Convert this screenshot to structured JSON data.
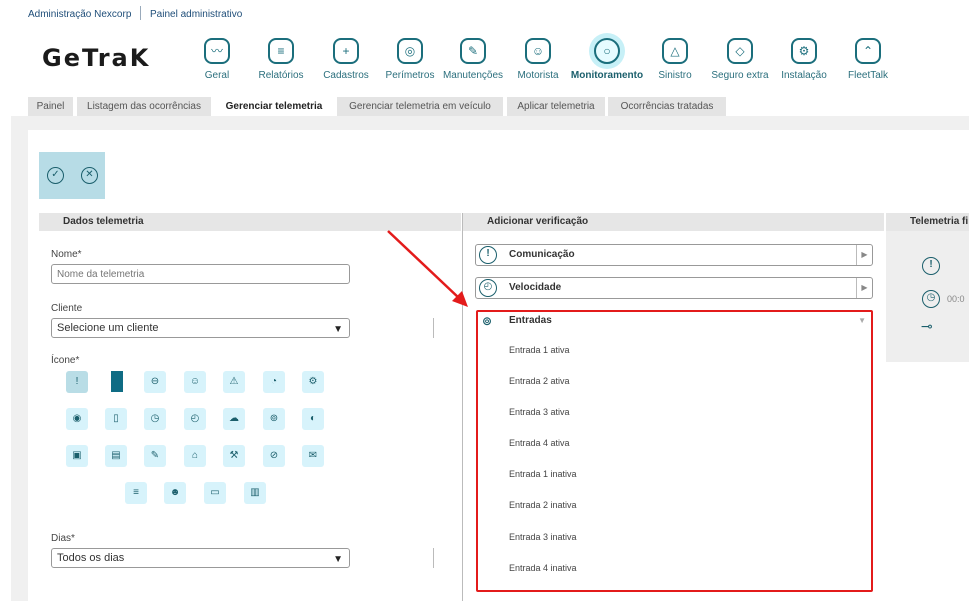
{
  "topbar": {
    "org": "Administração Nexcorp",
    "panel": "Painel administrativo"
  },
  "logo": {
    "text": "GeTraK"
  },
  "nav": [
    {
      "label": "Geral",
      "icon": "chart-icon",
      "glyph": "〰"
    },
    {
      "label": "Relatórios",
      "icon": "report-icon",
      "glyph": "≡"
    },
    {
      "label": "Cadastros",
      "icon": "folder-add-icon",
      "glyph": "+"
    },
    {
      "label": "Perímetros",
      "icon": "perimeter-icon",
      "glyph": "◎"
    },
    {
      "label": "Manutenções",
      "icon": "wrench-icon",
      "glyph": "✎"
    },
    {
      "label": "Motorista",
      "icon": "driver-icon",
      "glyph": "☺"
    },
    {
      "label": "Monitoramento",
      "icon": "monitor-icon",
      "glyph": "○"
    },
    {
      "label": "Sinistro",
      "icon": "alarm-icon",
      "glyph": "△"
    },
    {
      "label": "Seguro extra",
      "icon": "shield-icon",
      "glyph": "◇"
    },
    {
      "label": "Instalação",
      "icon": "install-icon",
      "glyph": "⚙"
    },
    {
      "label": "FleetTalk",
      "icon": "fleettalk-icon",
      "glyph": "⌃"
    }
  ],
  "tabs": [
    "Painel",
    "Listagem das ocorrências",
    "Gerenciar telemetria",
    "Gerenciar telemetria em veículo",
    "Aplicar telemetria",
    "Ocorrências tratadas"
  ],
  "actions": {
    "confirm_icon": "check-icon",
    "cancel_icon": "close-icon",
    "confirm_glyph": "✓",
    "cancel_glyph": "✕"
  },
  "left": {
    "header": "Dados telemetria",
    "name_label": "Nome*",
    "name_placeholder": "Nome da telemetria",
    "client_label": "Cliente",
    "client_value": "Selecione um cliente",
    "icon_label": "Ícone*",
    "days_label": "Dias*",
    "days_value": "Todos os dias"
  },
  "icon_grid": [
    {
      "name": "alert-icon",
      "glyph": "!"
    },
    {
      "name": "block-icon",
      "glyph": ""
    },
    {
      "name": "lock-icon",
      "glyph": "⊖"
    },
    {
      "name": "face-icon",
      "glyph": "☺"
    },
    {
      "name": "warning-icon",
      "glyph": "⚠"
    },
    {
      "name": "gauge-icon",
      "glyph": "◔"
    },
    {
      "name": "settings-icon",
      "glyph": "⚙"
    },
    {
      "name": "eye-icon",
      "glyph": "◉"
    },
    {
      "name": "battery-icon",
      "glyph": "▯"
    },
    {
      "name": "clock-icon",
      "glyph": "◷"
    },
    {
      "name": "speed-icon",
      "glyph": "◴"
    },
    {
      "name": "cloud-icon",
      "glyph": "☁"
    },
    {
      "name": "signal-icon",
      "glyph": "⊚"
    },
    {
      "name": "chat-icon",
      "glyph": "◐"
    },
    {
      "name": "card-icon",
      "glyph": "▣"
    },
    {
      "name": "device-icon",
      "glyph": "▤"
    },
    {
      "name": "pen-icon",
      "glyph": "✎"
    },
    {
      "name": "home-icon",
      "glyph": "⌂"
    },
    {
      "name": "tool-icon",
      "glyph": "⚒"
    },
    {
      "name": "clip-icon",
      "glyph": "⊘"
    },
    {
      "name": "mail-icon",
      "glyph": "✉"
    },
    {
      "name": "list-icon",
      "glyph": "≡"
    },
    {
      "name": "user-icon",
      "glyph": "☻"
    },
    {
      "name": "screen-icon",
      "glyph": "▭"
    },
    {
      "name": "doc-icon",
      "glyph": "▥"
    }
  ],
  "middle": {
    "header": "Adicionar verificação",
    "accordions": [
      {
        "label": "Comunicação",
        "icon": "alert-icon",
        "glyph": "!",
        "expanded": false
      },
      {
        "label": "Velocidade",
        "icon": "speedometer-icon",
        "glyph": "◴",
        "expanded": false
      },
      {
        "label": "Entradas",
        "icon": "signal-icon",
        "glyph": "⊚",
        "expanded": true
      }
    ],
    "entries": [
      "Entrada 1 ativa",
      "Entrada 2 ativa",
      "Entrada 3 ativa",
      "Entrada 4 ativa",
      "Entrada 1 inativa",
      "Entrada 2 inativa",
      "Entrada 3 inativa",
      "Entrada 4 inativa"
    ]
  },
  "right": {
    "header": "Telemetria fi",
    "time": "00:0",
    "alert_glyph": "!",
    "clock_glyph": "◷",
    "key_glyph": "⊸"
  },
  "colors": {
    "accent": "#1b5f6c",
    "highlight": "#e31b1b",
    "tab_bg": "#e4e4e4"
  }
}
